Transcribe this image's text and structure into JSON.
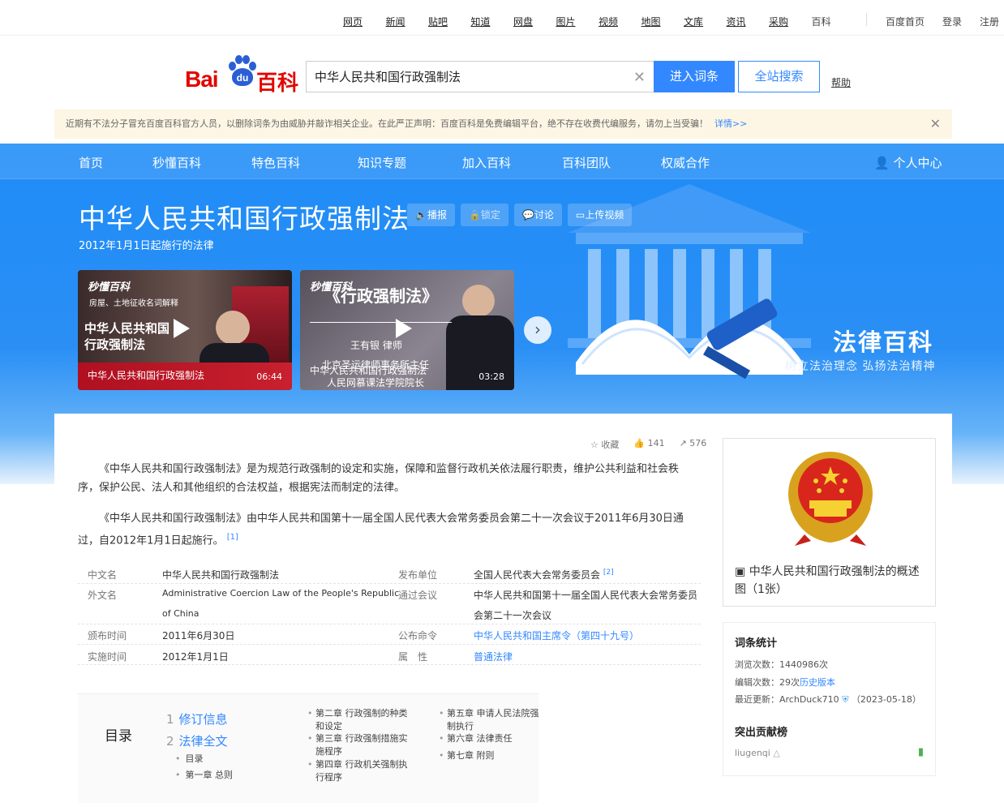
{
  "topnav": {
    "links": [
      "网页",
      "新闻",
      "贴吧",
      "知道",
      "网盘",
      "图片",
      "视频",
      "地图",
      "文库",
      "资讯",
      "采购",
      "百科"
    ],
    "right": [
      "百度首页",
      "登录",
      "注册"
    ]
  },
  "logo": {
    "bai": "Bai",
    "du": "du",
    "baike": "百科"
  },
  "search": {
    "value": "中华人民共和国行政强制法",
    "enter_label": "进入词条",
    "all_label": "全站搜索",
    "help_label": "帮助"
  },
  "notice": {
    "text": "近期有不法分子冒充百度百科官方人员，以删除词条为由威胁并敲诈相关企业。在此严正声明：百度百科是免费编辑平台，绝不存在收费代编服务，请勿上当受骗！",
    "more": "详情>>"
  },
  "mainnav": {
    "items": [
      "首页",
      "秒懂百科",
      "特色百科",
      "知识专题",
      "加入百科",
      "百科团队",
      "权威合作"
    ],
    "user": "个人中心"
  },
  "entry": {
    "title": "中华人民共和国行政强制法",
    "buttons": [
      "播报",
      "锁定",
      "讨论",
      "上传视频"
    ],
    "subtitle": "2012年1月1日起施行的法律"
  },
  "videos": [
    {
      "brand": "秒懂百科",
      "tagline": "房屋、土地征收名词解释",
      "headline": "中华人民共和国\n行政强制法",
      "caption": "中华人民共和国行政强制法",
      "duration": "06:44"
    },
    {
      "brand": "秒懂百科",
      "headline": "《行政强制法》",
      "person": "王有银 律师",
      "org1": "北京圣运律师事务所主任",
      "org2": "人民网慕课法学院院长",
      "caption": "中华人民共和国行政强制法",
      "duration": "03:28"
    }
  ],
  "banner_right": {
    "title": "法律百科",
    "slogan": "树立法治理念 弘扬法治精神"
  },
  "actions": {
    "favorite": "收藏",
    "likes": "141",
    "shares": "576"
  },
  "paragraphs": [
    "《中华人民共和国行政强制法》是为规范行政强制的设定和实施，保障和监督行政机关依法履行职责，维护公共利益和社会秩序，保护公民、法人和其他组织的合法权益，根据宪法而制定的法律。",
    "《中华人民共和国行政强制法》由中华人民共和国第十一届全国人民代表大会常务委员会第二十一次会议于2011年6月30日通过，自2012年1月1日起施行。"
  ],
  "para2_ref": "[1]",
  "info": {
    "left": [
      {
        "k": "中文名",
        "v": "中华人民共和国行政强制法"
      },
      {
        "k": "外文名",
        "v": "Administrative Coercion Law of the People's Republic",
        "v2": "of China"
      },
      {
        "k": "颁布时间",
        "v": "2011年6月30日"
      },
      {
        "k": "实施时间",
        "v": "2012年1月1日"
      }
    ],
    "right": [
      {
        "k": "发布单位",
        "v": "全国人民代表大会常务委员会",
        "ref": "[2]"
      },
      {
        "k": "通过会议",
        "v": "中华人民共和国第十一届全国人民代表大会常务委员",
        "v2": "会第二十一次会议"
      },
      {
        "k": "公布命令",
        "v": "中华人民共和国主席令（第四十九号）"
      },
      {
        "k": "属　性",
        "v": "普通法律"
      }
    ]
  },
  "toc": {
    "heading": "目录",
    "sections": [
      {
        "num": "1",
        "label": "修订信息"
      },
      {
        "num": "2",
        "label": "法律全文"
      }
    ],
    "sub": [
      "目录",
      "第一章 总则"
    ],
    "col1": [
      "第二章 行政强制的种类和设定",
      "第三章 行政强制措施实施程序",
      "第四章 行政机关强制执行程序"
    ],
    "col2": [
      "第五章 申请人民法院强制执行",
      "第六章 法律责任",
      "第七章 附则"
    ]
  },
  "sidebar": {
    "image_caption": "中华人民共和国行政强制法的概述图（1张）",
    "stats_title": "词条统计",
    "views_label": "浏览次数：",
    "views": "1440986次",
    "edits_label": "编辑次数：",
    "edits": "29次",
    "history": "历史版本",
    "updated_label": "最近更新：",
    "updated_user": "ArchDuck710",
    "updated_date": "（2023-05-18）",
    "contrib_title": "突出贡献榜",
    "contributor": "liugenqi"
  }
}
